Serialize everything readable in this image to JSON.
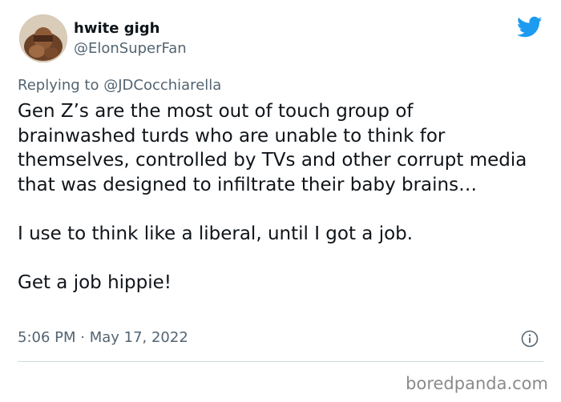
{
  "user": {
    "display_name": "hwite gigh",
    "handle": "@ElonSuperFan",
    "avatar_icon": "profile-photo"
  },
  "reply": {
    "text": "Replying to @JDCocchiarella"
  },
  "tweet": {
    "paragraphs": [
      "Gen Z’s are the most out of touch group of brainwashed turds who are unable to think for themselves, controlled by TVs and other corrupt media that was designed to infiltrate their baby brains…",
      "I use to think like a liberal, until I got a job.",
      "Get a job hippie!"
    ],
    "timestamp": "5:06 PM · May 17, 2022"
  },
  "icons": {
    "brand": "twitter-bird-icon",
    "info": "info-icon"
  },
  "colors": {
    "twitter_blue": "#1d9bf0",
    "secondary_text": "#536471"
  },
  "watermark": "boredpanda.com"
}
